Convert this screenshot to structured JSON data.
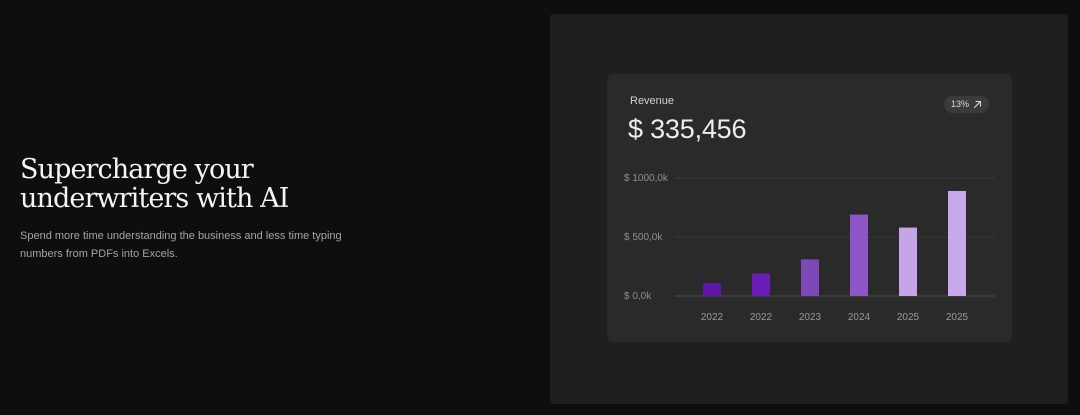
{
  "hero": {
    "title_line1": "Supercharge your",
    "title_line2": "underwriters with AI",
    "subtitle": "Spend more time understanding the business and less time typing numbers from PDFs into Excels."
  },
  "card": {
    "label": "Revenue",
    "value": "$ 335,456",
    "badge": {
      "text": "13%",
      "icon": "arrow-up-right-icon"
    }
  },
  "colors": {
    "page_background": "#100e0d",
    "panel_background": "#1f1f1f",
    "card_background": "#2a2a2a",
    "bar_colors": [
      "#5f16a8",
      "#6a1db6",
      "#7d48b8",
      "#8d57c8",
      "#c4a5e8",
      "#c7a8ea"
    ]
  },
  "chart_data": {
    "type": "bar",
    "categories": [
      "2022",
      "2022",
      "2023",
      "2024",
      "2025",
      "2025"
    ],
    "values": [
      110,
      190,
      310,
      690,
      580,
      890
    ],
    "unit": "k",
    "ylim": [
      0,
      1000
    ],
    "y_ticks": [
      {
        "value": 0,
        "label": "$ 0,0k"
      },
      {
        "value": 500,
        "label": "$ 500,0k"
      },
      {
        "value": 1000,
        "label": "$ 1000,0k"
      }
    ],
    "grid": true,
    "title": "",
    "xlabel": "",
    "ylabel": ""
  }
}
